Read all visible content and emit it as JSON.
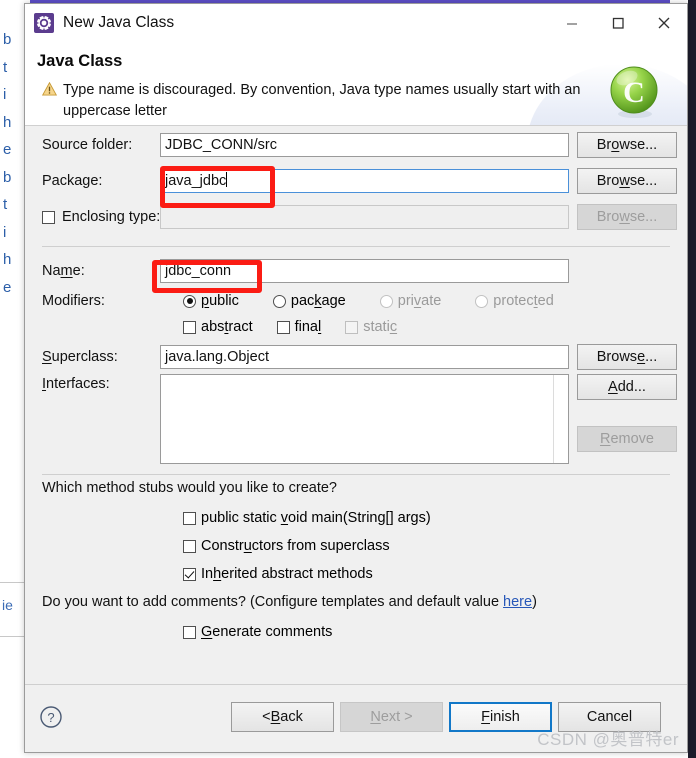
{
  "window": {
    "title": "New Java Class",
    "icon": "java-wizard-icon",
    "controls": {
      "minimize": "minimize-icon",
      "maximize": "maximize-icon",
      "close": "close-icon"
    }
  },
  "header": {
    "title": "Java Class",
    "message": "Type name is discouraged. By convention, Java type names usually start with an uppercase letter",
    "status_icon": "warning-icon",
    "banner_icon": "java-class-banner-icon"
  },
  "form": {
    "source_folder": {
      "label": "Source folder:",
      "value": "JDBC_CONN/src",
      "button": "Browse..."
    },
    "package": {
      "label": "Package:",
      "value": "java_jdbc",
      "button": "Browse...",
      "focused": true
    },
    "enclosing_type": {
      "label": "Enclosing type:",
      "value": "",
      "button": "Browse...",
      "checked": false,
      "disabled": true
    },
    "name": {
      "label": "Name:",
      "value": "jdbc_conn"
    },
    "modifiers": {
      "label": "Modifiers:",
      "radios": [
        {
          "label": "public",
          "selected": true,
          "disabled": false
        },
        {
          "label": "package",
          "selected": false,
          "disabled": false
        },
        {
          "label": "private",
          "selected": false,
          "disabled": true
        },
        {
          "label": "protected",
          "selected": false,
          "disabled": true
        }
      ],
      "checkboxes": [
        {
          "label": "abstract",
          "checked": false,
          "disabled": false
        },
        {
          "label": "final",
          "checked": false,
          "disabled": false
        },
        {
          "label": "static",
          "checked": false,
          "disabled": true
        }
      ]
    },
    "superclass": {
      "label": "Superclass:",
      "value": "java.lang.Object",
      "button": "Browse..."
    },
    "interfaces": {
      "label": "Interfaces:",
      "items": [],
      "add_button": "Add...",
      "remove_button": "Remove"
    }
  },
  "stubs": {
    "question": "Which method stubs would you like to create?",
    "options": [
      {
        "label": "public static void main(String[] args)",
        "checked": false
      },
      {
        "label": "Constructors from superclass",
        "checked": false
      },
      {
        "label": "Inherited abstract methods",
        "checked": true
      }
    ]
  },
  "comments": {
    "question_prefix": "Do you want to add comments? (Configure templates and default value ",
    "link": "here",
    "question_suffix": ")",
    "option": {
      "label": "Generate comments",
      "checked": false
    }
  },
  "footer": {
    "help_icon": "help-icon",
    "buttons": [
      {
        "label": "< Back",
        "disabled": false,
        "focused": false
      },
      {
        "label": "Next >",
        "disabled": true,
        "focused": false
      },
      {
        "label": "Finish",
        "disabled": false,
        "focused": true
      },
      {
        "label": "Cancel",
        "disabled": false,
        "focused": false
      }
    ],
    "watermark": "CSDN @奥普特er"
  },
  "background": {
    "code_gutter": "b\nt\ni\nh\ne\nb\nt\ni\nh\ne",
    "bottom_fragment": "ie"
  },
  "colors": {
    "accent_focus": "#1278c8",
    "annotation": "#fb1c14",
    "link": "#2757b8",
    "title_icon": "#5b3c8e",
    "dialog_bg": "#f0f0f0"
  }
}
